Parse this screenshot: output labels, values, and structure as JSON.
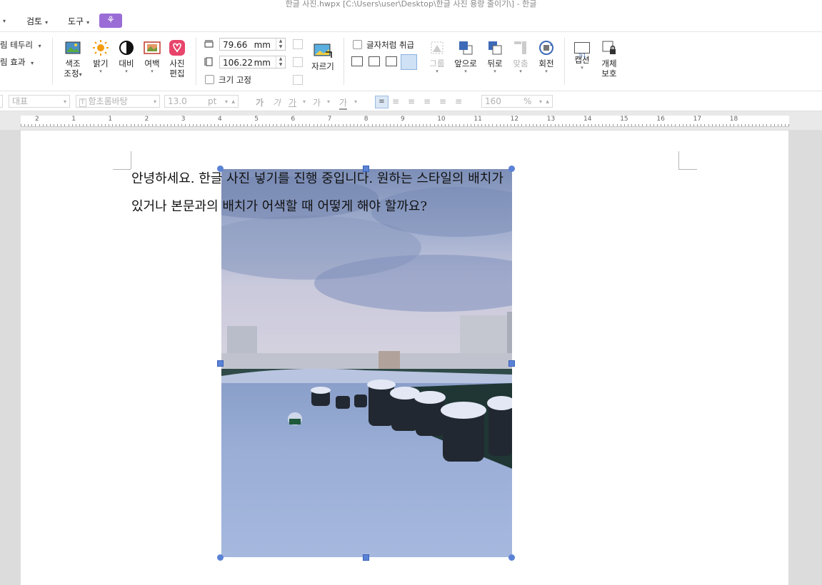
{
  "window": {
    "title": "한글 사진.hwpx [C:\\Users\\user\\Desktop\\한글 사진 용량 줄이기\\] - 한글"
  },
  "menu": {
    "items": [
      {
        "label": "검토"
      },
      {
        "label": "도구"
      }
    ],
    "app_icon": "tulip-icon"
  },
  "ribbon": {
    "border_label": "림 테두리",
    "effect_label": "림 효과",
    "color_adjust": "색조\n조정",
    "brightness": "밝기",
    "contrast": "대비",
    "margin": "여백",
    "photo_edit": "사진\n편집",
    "width_value": "79.66",
    "height_value": "106.22",
    "unit": "mm",
    "fix_size": "크기 고정",
    "crop": "자르기",
    "treat_as_char": "글자처럼 취급",
    "group": "그룹",
    "front": "앞으로",
    "back": "뒤로",
    "align": "맞춤",
    "rotate": "회전",
    "caption": "캡션",
    "protect": "개체\n보호",
    "caption_icon_text": "가1"
  },
  "format": {
    "style": "대표",
    "font": "함초롬바탕",
    "font_size": "13.0",
    "size_unit": "pt",
    "line_spacing": "160",
    "spacing_unit": "%",
    "font_type_badge": "T"
  },
  "ruler": {
    "numbers": [
      "2",
      "1",
      "1",
      "2",
      "3",
      "4",
      "5",
      "6",
      "7",
      "8",
      "9",
      "10",
      "11",
      "12",
      "13",
      "14",
      "15",
      "16",
      "17",
      "18"
    ]
  },
  "document": {
    "line1": "안녕하세요. 한글 사진 넣기를 진행 중입니다. 원하는 스타일의 배치가",
    "line2": "있거나 본문과의 배치가 어색할 때 어떻게 해야 할까요?"
  },
  "colors": {
    "accent": "#9a6cd6",
    "handle": "#5a82d6",
    "brightness": "#f39c12",
    "photo_edit": "#e8456b"
  }
}
